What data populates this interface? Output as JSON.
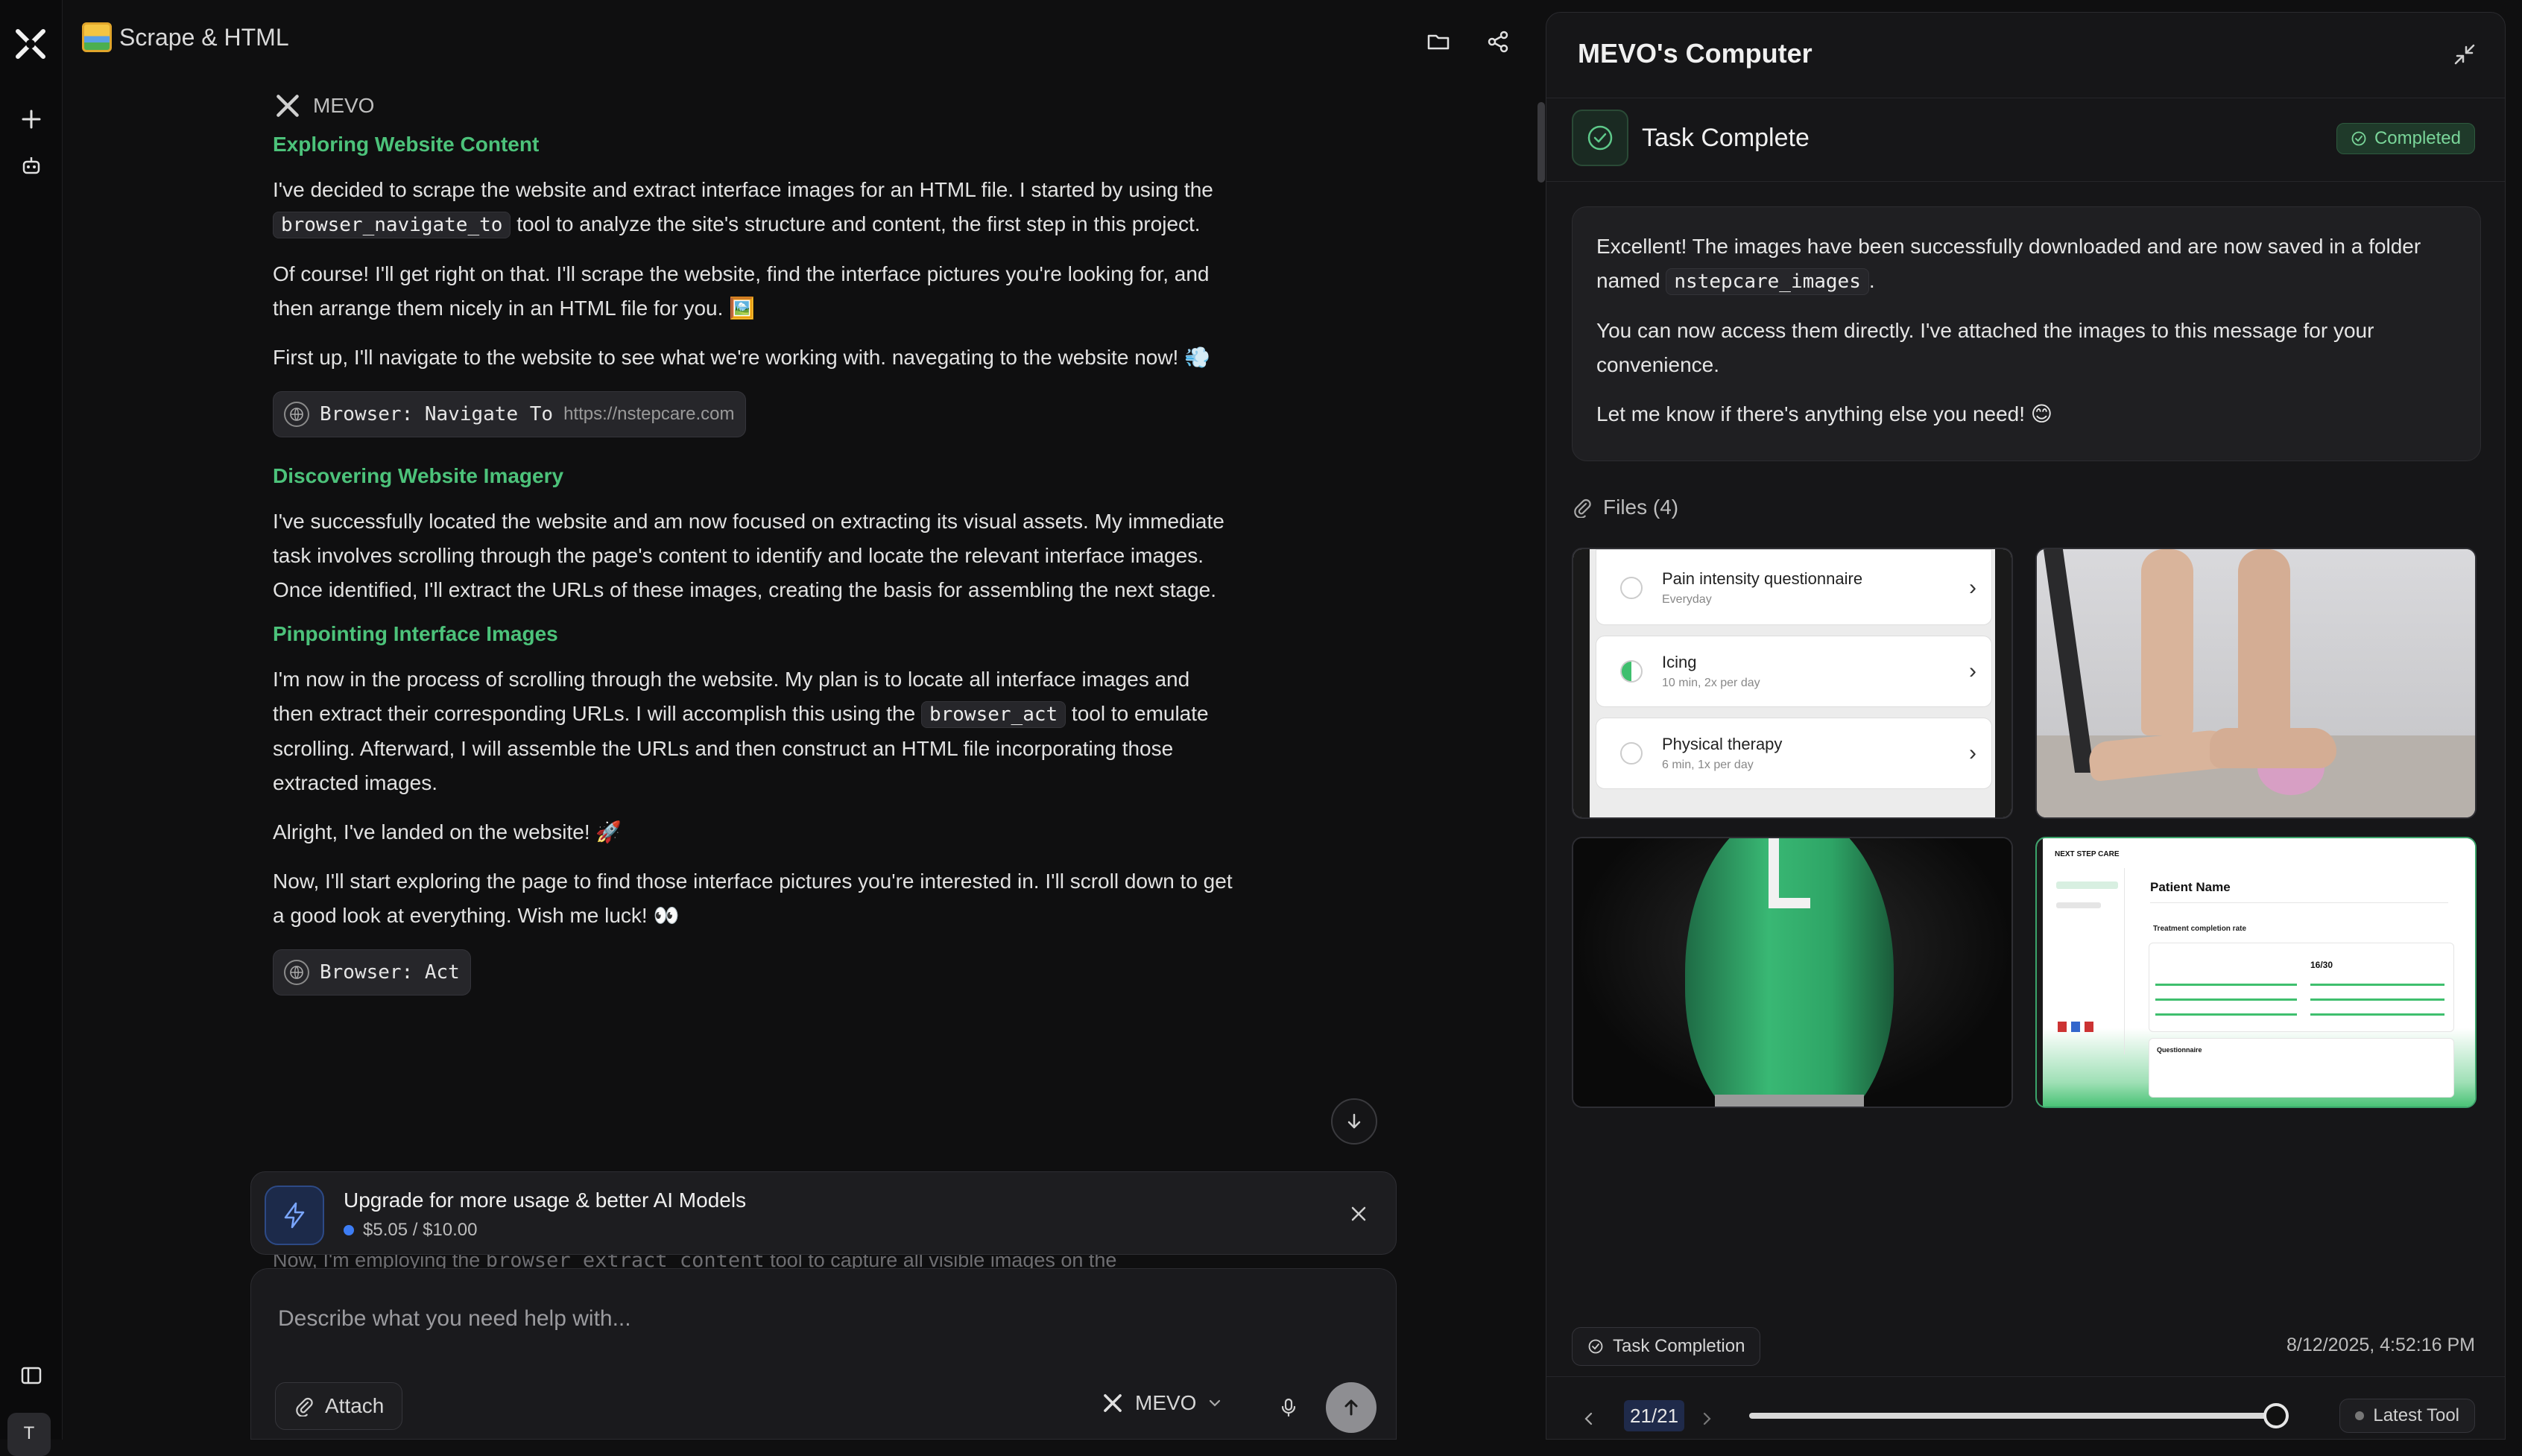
{
  "header": {
    "title": "Scrape & HTML"
  },
  "agent": {
    "name": "MEVO"
  },
  "chat": {
    "s1_title": "Exploring Website Content",
    "p1_a": "I've decided to scrape the website and extract interface images for an HTML file. I started by using the ",
    "p1_code": "browser_navigate_to",
    "p1_b": " tool to analyze the site's structure and content, the first step in this project.",
    "p2": "Of course! I'll get right on that. I'll scrape the website, find the interface pictures you're looking for, and then arrange them nicely in an HTML file for you. 🖼️",
    "p3": "First up, I'll navigate to the website to see what we're working with. navegating to the website now! 💨",
    "tool1_label": "Browser: Navigate To",
    "tool1_url": "https://nstepcare.com",
    "s2_title": "Discovering Website Imagery",
    "p4": "I've successfully located the website and am now focused on extracting its visual assets. My immediate task involves scrolling through the page's content to identify and locate the relevant interface images. Once identified, I'll extract the URLs of these images, creating the basis for assembling the next stage.",
    "s3_title": "Pinpointing Interface Images",
    "p5_a": "I'm now in the process of scrolling through the website. My plan is to locate all interface images and then extract their corresponding URLs. I will accomplish this using the ",
    "p5_code": "browser_act",
    "p5_b": " tool to emulate scrolling. Afterward, I will assemble the URLs and then construct an HTML file incorporating those extracted images.",
    "p6": "Alright, I've landed on the website! 🚀",
    "p7": "Now, I'll start exploring the page to find those interface pictures you're interested in. I'll scroll down to get a good look at everything. Wish me luck! 👀",
    "tool2_label": "Browser: Act",
    "peek_a": "Now, I'm employing the ",
    "peek_code": "browser_extract_content",
    "peek_b": " tool to capture all visible images on the"
  },
  "upgrade": {
    "title": "Upgrade for more usage & better AI Models",
    "usage": "$5.05 / $10.00"
  },
  "input": {
    "placeholder": "Describe what you need help with...",
    "attach_label": "Attach",
    "model": "MEVO"
  },
  "panel": {
    "title": "MEVO's Computer",
    "status_label": "Task Complete",
    "badge": "Completed",
    "msg1_a": "Excellent! The images have been successfully downloaded and are now saved in a folder named ",
    "msg1_code": "nstepcare_images",
    "msg1_b": ".",
    "msg2": "You can now access them directly. I've attached the images to this message for your convenience.",
    "msg3": "Let me know if there's anything else you need! 😊",
    "files_label": "Files (4)",
    "thumb1": {
      "rows": [
        {
          "title": "Pain intensity questionnaire",
          "sub": "Everyday"
        },
        {
          "title": "Icing",
          "sub": "10 min, 2x per day"
        },
        {
          "title": "Physical therapy",
          "sub": "6 min, 1x per day"
        }
      ]
    },
    "thumb4": {
      "brand": "NEXT STEP CARE",
      "heading": "Patient Name",
      "sub": "Treatment completion rate",
      "metric": "16/30",
      "footer": "Questionnaire"
    },
    "step_label": "Task Completion",
    "timestamp": "8/12/2025, 4:52:16 PM",
    "pager": "21/21",
    "progress": 1.0,
    "latest": "Latest Tool"
  },
  "colors": {
    "accent_green": "#4cc27a",
    "badge_green": "#7ad69a",
    "usage_dot": "#3d7df5"
  }
}
